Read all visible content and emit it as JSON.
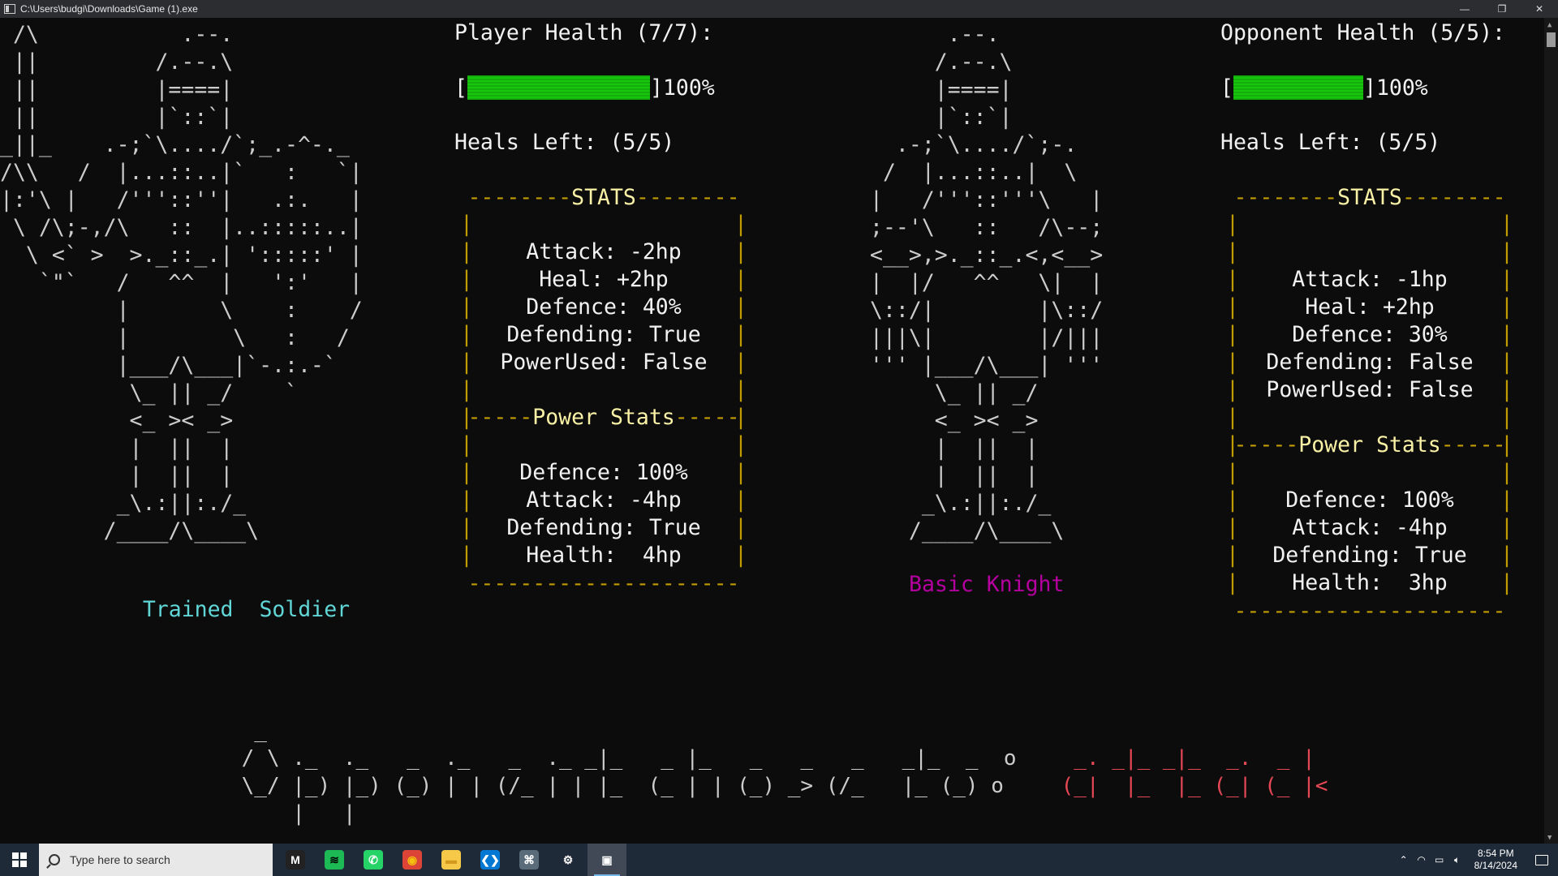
{
  "window": {
    "title": "C:\\Users\\budgi\\Downloads\\Game (1).exe",
    "minimize": "—",
    "restore": "❐",
    "close": "✕"
  },
  "player": {
    "art": " /\\           .--.\n ||         /.--.\\\n ||         |====|\n ||         |`::`|\n_||_    .-;`\\..../`;_.-^-._\n/\\\\   /  |...::..|`   :   `|\n|:'\\ |   /'''::''|   .:.   |\n \\ /\\;-,/\\   ::  |..:::::..|\n  \\ <` >  >._::_.| ':::::' |\n   `\"`   /   ^^  |   ':'   |\n         |       \\    :    /\n         |        \\   :   /\n         |___/\\___|`-.:.-`\n          \\_ || _/    `\n          <_ >< _>\n          |  ||  |\n          |  ||  |\n         _\\.:||:./_\n        /____/\\____\\",
    "name_part1": "Trained",
    "name_part2": "Soldier",
    "health_label": "Player Health (7/7):",
    "health_fraction": 1.0,
    "health_percent": "100%",
    "heals_left": "Heals Left: (5/5)",
    "stats_header_left": "--------",
    "stats_header_title": "STATS",
    "stats_header_right": "--------",
    "stats": [
      "Attack: -2hp",
      "Heal: +2hp",
      "Defence: 40%",
      "Defending: True",
      "PowerUsed: False"
    ],
    "power_header_left": "-----",
    "power_header_title": "Power Stats",
    "power_header_right": "-----",
    "power_stats": [
      "Defence: 100%",
      "Attack: -4hp",
      "Defending: True",
      "Health:  4hp"
    ],
    "footer_line": "---------------------"
  },
  "opponent": {
    "art": "      .--.\n     /.--.\\\n     |====|\n     |`::`|\n  .-;`\\..../`;-.\n /  |...::..|  \\\n|   /'''::'''\\   |\n;--'\\   ::   /\\--;\n<__>,>._::_.<,<__>\n|  |/   ^^   \\|  |\n\\::/|        |\\::/\n|||\\|        |/|||\n''' |___/\\___| '''\n     \\_ || _/\n     <_ >< _>\n     |  ||  |\n     |  ||  |\n    _\\.:||:./_\n   /____/\\____\\",
    "name": "Basic Knight",
    "health_label": "Opponent Health (5/5):",
    "health_fraction": 1.0,
    "health_percent": "100%",
    "heals_left": "Heals Left: (5/5)",
    "stats_header_left": "--------",
    "stats_header_title": "STATS",
    "stats_header_right": "--------",
    "stats": [
      "Attack: -1hp",
      "Heal: +2hp",
      "Defence: 30%",
      "Defending: False",
      "PowerUsed: False"
    ],
    "power_header_left": "-----",
    "power_header_title": "Power Stats",
    "power_header_right": "-----",
    "power_stats": [
      "Defence: 100%",
      "Attack: -4hp",
      "Defending: True",
      "Health:  3hp"
    ],
    "footer_line": "---------------------"
  },
  "banner": {
    "white": "  _                                                       \n / \\ ._  ._   _  ._   _  ._ _|_   _ |_   _   _   _   _|_  _  o\n \\_/ |_) |_) (_) | | (/_ | | |_  (_ | | (_) _> (/_   |_ (_) o\n     |   |                                                   ",
    "red": "\n  _. _|_ _|_  _.  _ |\n (_|  |_  |_ (_| (_ |<\n",
    "text_meaning": "Opponent chose to: attack"
  },
  "taskbar": {
    "search_placeholder": "Type here to search",
    "time": "8:54 PM",
    "date": "8/14/2024",
    "pinned": [
      {
        "name": "m-app-icon",
        "glyph": "M",
        "color": "#222222",
        "fg": "#ffffff"
      },
      {
        "name": "spotify-icon",
        "glyph": "≋",
        "color": "#1db954",
        "fg": "#000000"
      },
      {
        "name": "whatsapp-icon",
        "glyph": "✆",
        "color": "#25d366",
        "fg": "#ffffff"
      },
      {
        "name": "chrome-icon",
        "glyph": "◉",
        "color": "#db4437",
        "fg": "#f4c20d"
      },
      {
        "name": "file-explorer-icon",
        "glyph": "▬",
        "color": "#f7c948",
        "fg": "#d49a1f"
      },
      {
        "name": "vscode-icon",
        "glyph": "❮❯",
        "color": "#0078d4",
        "fg": "#ffffff"
      },
      {
        "name": "game-controller-icon",
        "glyph": "⌘",
        "color": "#5a6b7a",
        "fg": "#ffffff"
      },
      {
        "name": "settings-icon",
        "glyph": "⚙",
        "color": "transparent",
        "fg": "#ffffff"
      },
      {
        "name": "console-app-icon",
        "glyph": "▣",
        "color": "transparent",
        "fg": "#ffffff"
      }
    ]
  }
}
